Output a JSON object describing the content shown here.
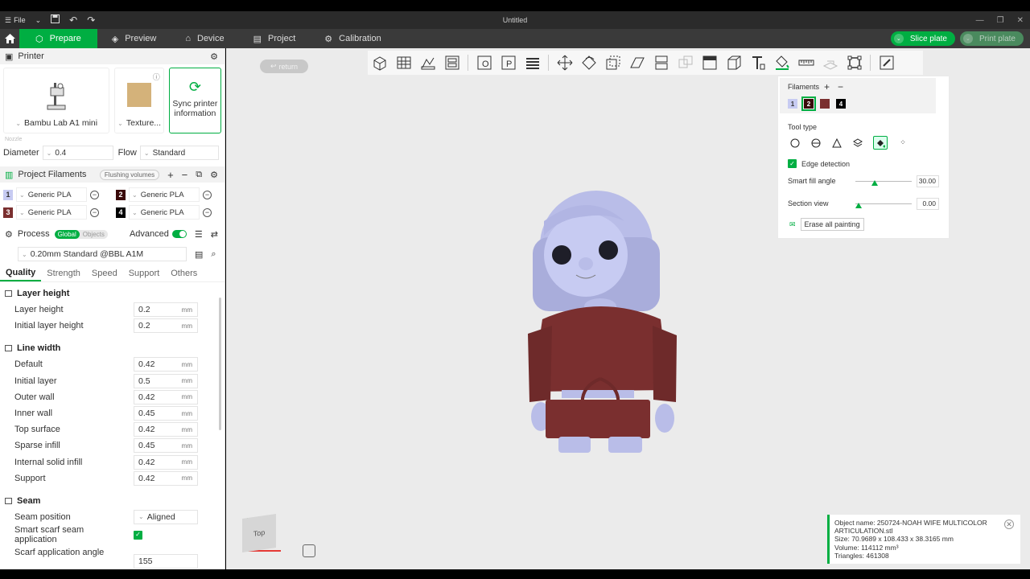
{
  "window": {
    "title": "Untitled",
    "file_menu": "File"
  },
  "tabs": [
    {
      "label": "Prepare",
      "active": true
    },
    {
      "label": "Preview"
    },
    {
      "label": "Device"
    },
    {
      "label": "Project"
    },
    {
      "label": "Calibration"
    }
  ],
  "actions": {
    "slice": "Slice plate",
    "print": "Print plate"
  },
  "printer_section": {
    "title": "Printer",
    "printer_name": "Bambu Lab A1 mini",
    "plate_name": "Texture...",
    "sync_label": "Sync printer information",
    "nozzle_label": "Nozzle",
    "diameter_label": "Diameter",
    "diameter_value": "0.4",
    "flow_label": "Flow",
    "flow_value": "Standard"
  },
  "filaments_section": {
    "title": "Project Filaments",
    "flushing": "Flushing volumes",
    "items": [
      {
        "num": "1",
        "name": "Generic PLA",
        "color": "#c7cbf2",
        "text": "#333"
      },
      {
        "num": "2",
        "name": "Generic PLA",
        "color": "#3a0a0a",
        "text": "#fff"
      },
      {
        "num": "3",
        "name": "Generic PLA",
        "color": "#7a2f2f",
        "text": "#fff"
      },
      {
        "num": "4",
        "name": "Generic PLA",
        "color": "#000000",
        "text": "#fff"
      }
    ]
  },
  "process": {
    "title": "Process",
    "seg_global": "Global",
    "seg_objects": "Objects",
    "advanced": "Advanced",
    "preset": "0.20mm Standard @BBL A1M",
    "tabs": [
      "Quality",
      "Strength",
      "Speed",
      "Support",
      "Others"
    ]
  },
  "quality": {
    "layer_height_group": "Layer height",
    "layer_height": {
      "label": "Layer height",
      "value": "0.2",
      "unit": "mm"
    },
    "initial_layer_height": {
      "label": "Initial layer height",
      "value": "0.2",
      "unit": "mm"
    },
    "line_width_group": "Line width",
    "line_width": [
      {
        "label": "Default",
        "value": "0.42",
        "unit": "mm"
      },
      {
        "label": "Initial layer",
        "value": "0.5",
        "unit": "mm"
      },
      {
        "label": "Outer wall",
        "value": "0.42",
        "unit": "mm"
      },
      {
        "label": "Inner wall",
        "value": "0.45",
        "unit": "mm"
      },
      {
        "label": "Top surface",
        "value": "0.42",
        "unit": "mm"
      },
      {
        "label": "Sparse infill",
        "value": "0.45",
        "unit": "mm"
      },
      {
        "label": "Internal solid infill",
        "value": "0.42",
        "unit": "mm"
      },
      {
        "label": "Support",
        "value": "0.42",
        "unit": "mm"
      }
    ],
    "seam_group": "Seam",
    "seam_position": {
      "label": "Seam position",
      "value": "Aligned"
    },
    "smart_scarf": {
      "label": "Smart scarf seam application",
      "checked": true
    },
    "scarf_angle": {
      "label": "Scarf application angle",
      "value": "155"
    }
  },
  "viewport": {
    "return_label": "return",
    "navcube_label": "Top"
  },
  "paint_panel": {
    "filaments_label": "Filaments",
    "swatches": [
      {
        "num": "1",
        "color": "#c7cbf2",
        "text": "#333",
        "selected": false
      },
      {
        "num": "2",
        "color": "#3a0a0a",
        "text": "#fff",
        "selected": true
      },
      {
        "num": "3",
        "color": "#7a2f2f",
        "text": "#7a2f2f",
        "selected": false
      },
      {
        "num": "4",
        "color": "#000000",
        "text": "#fff",
        "selected": false
      }
    ],
    "tool_type_label": "Tool type",
    "edge_detection": "Edge detection",
    "smart_fill_label": "Smart fill angle",
    "smart_fill_value": "30.00",
    "section_view_label": "Section view",
    "section_view_value": "0.00",
    "erase_label": "Erase all painting"
  },
  "object_info": {
    "line1": "Object name: 250724-NOAH WIFE MULTICOLOR",
    "line2": "ARTICULATION.stl",
    "line3": "Size: 70.9689 x 108.433 x 38.3165 mm",
    "line4": "Volume: 114112 mm³",
    "line5": "Triangles: 461308"
  },
  "colors": {
    "accent": "#00ae42",
    "hair": "#b9bde8",
    "dress": "#7a2f2f"
  }
}
